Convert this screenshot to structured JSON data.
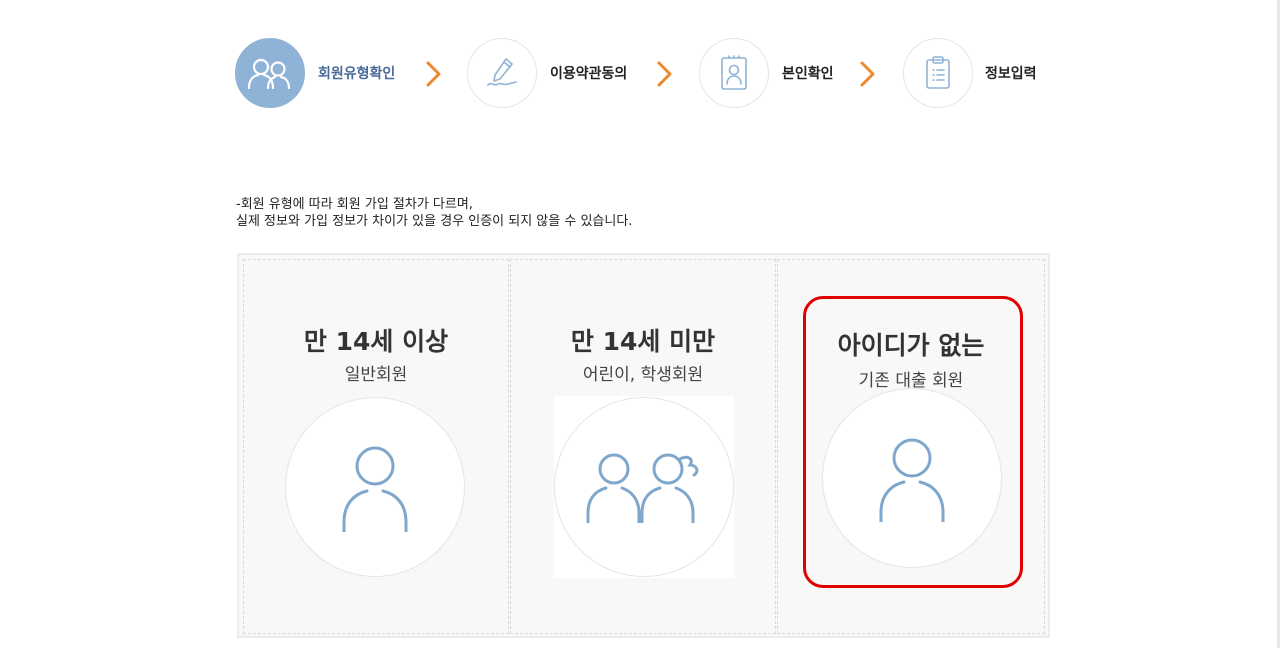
{
  "steps": [
    {
      "label": "회원유형확인",
      "icon": "users-icon",
      "active": true
    },
    {
      "label": "이용약관동의",
      "icon": "pen-sign-icon",
      "active": false
    },
    {
      "label": "본인확인",
      "icon": "id-card-icon",
      "active": false
    },
    {
      "label": "정보입력",
      "icon": "clipboard-icon",
      "active": false
    }
  ],
  "description": {
    "line1": "-회원 유형에 따라 회원 가입 절차가 다르며,",
    "line2": "실제 정보와 가입 정보가 차이가 있을 경우 인증이 되지 않을 수 있습니다."
  },
  "cards": [
    {
      "title": "만 14세 이상",
      "subtitle": "일반회원",
      "icon": "single-user-icon"
    },
    {
      "title": "만 14세 미만",
      "subtitle": "어린이, 학생회원",
      "icon": "two-users-icon"
    },
    {
      "title": "아이디가 없는",
      "subtitle": "기존 대출 회원",
      "icon": "single-user-icon"
    }
  ],
  "colors": {
    "accent_blue": "#8fb3d6",
    "icon_blue": "#7fa7cc",
    "chevron_orange": "#e98a2e",
    "highlight_red": "#e00000"
  }
}
